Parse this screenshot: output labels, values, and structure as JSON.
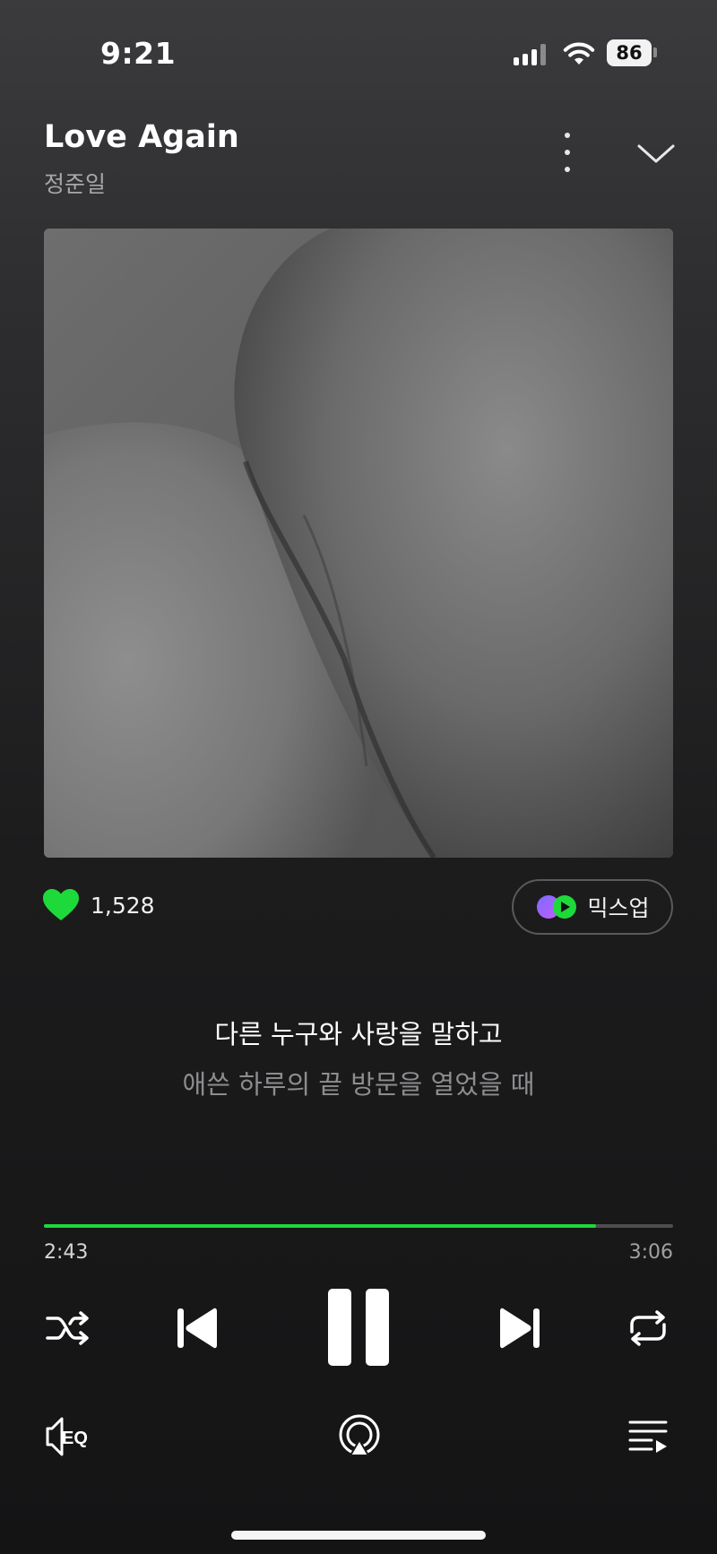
{
  "status_bar": {
    "time": "9:21",
    "battery": "86"
  },
  "song": {
    "title": "Love Again",
    "artist": "정준일"
  },
  "icons": {
    "more": "more-vertical-icon",
    "collapse": "chevron-down-icon",
    "like": "heart-icon",
    "mixup": "mixup-icon",
    "shuffle": "shuffle-icon",
    "previous": "skip-previous-icon",
    "pause": "pause-icon",
    "next": "skip-next-icon",
    "repeat": "repeat-icon",
    "eq": "eq-icon",
    "airplay": "airplay-icon",
    "queue": "playlist-icon"
  },
  "actions": {
    "like_count": "1,528",
    "mixup_label": "믹스업"
  },
  "lyrics": {
    "current": "다른 누구와 사랑을 말하고",
    "next": "애쓴 하루의 끝 방문을 열었을 때"
  },
  "playback": {
    "elapsed": "2:43",
    "total": "3:06",
    "progress_fraction": 0.877,
    "state": "playing"
  },
  "colors": {
    "accent": "#1ed93a",
    "heart": "#1ed93a",
    "background_top": "#3b3b3d",
    "background_bottom": "#141415"
  }
}
